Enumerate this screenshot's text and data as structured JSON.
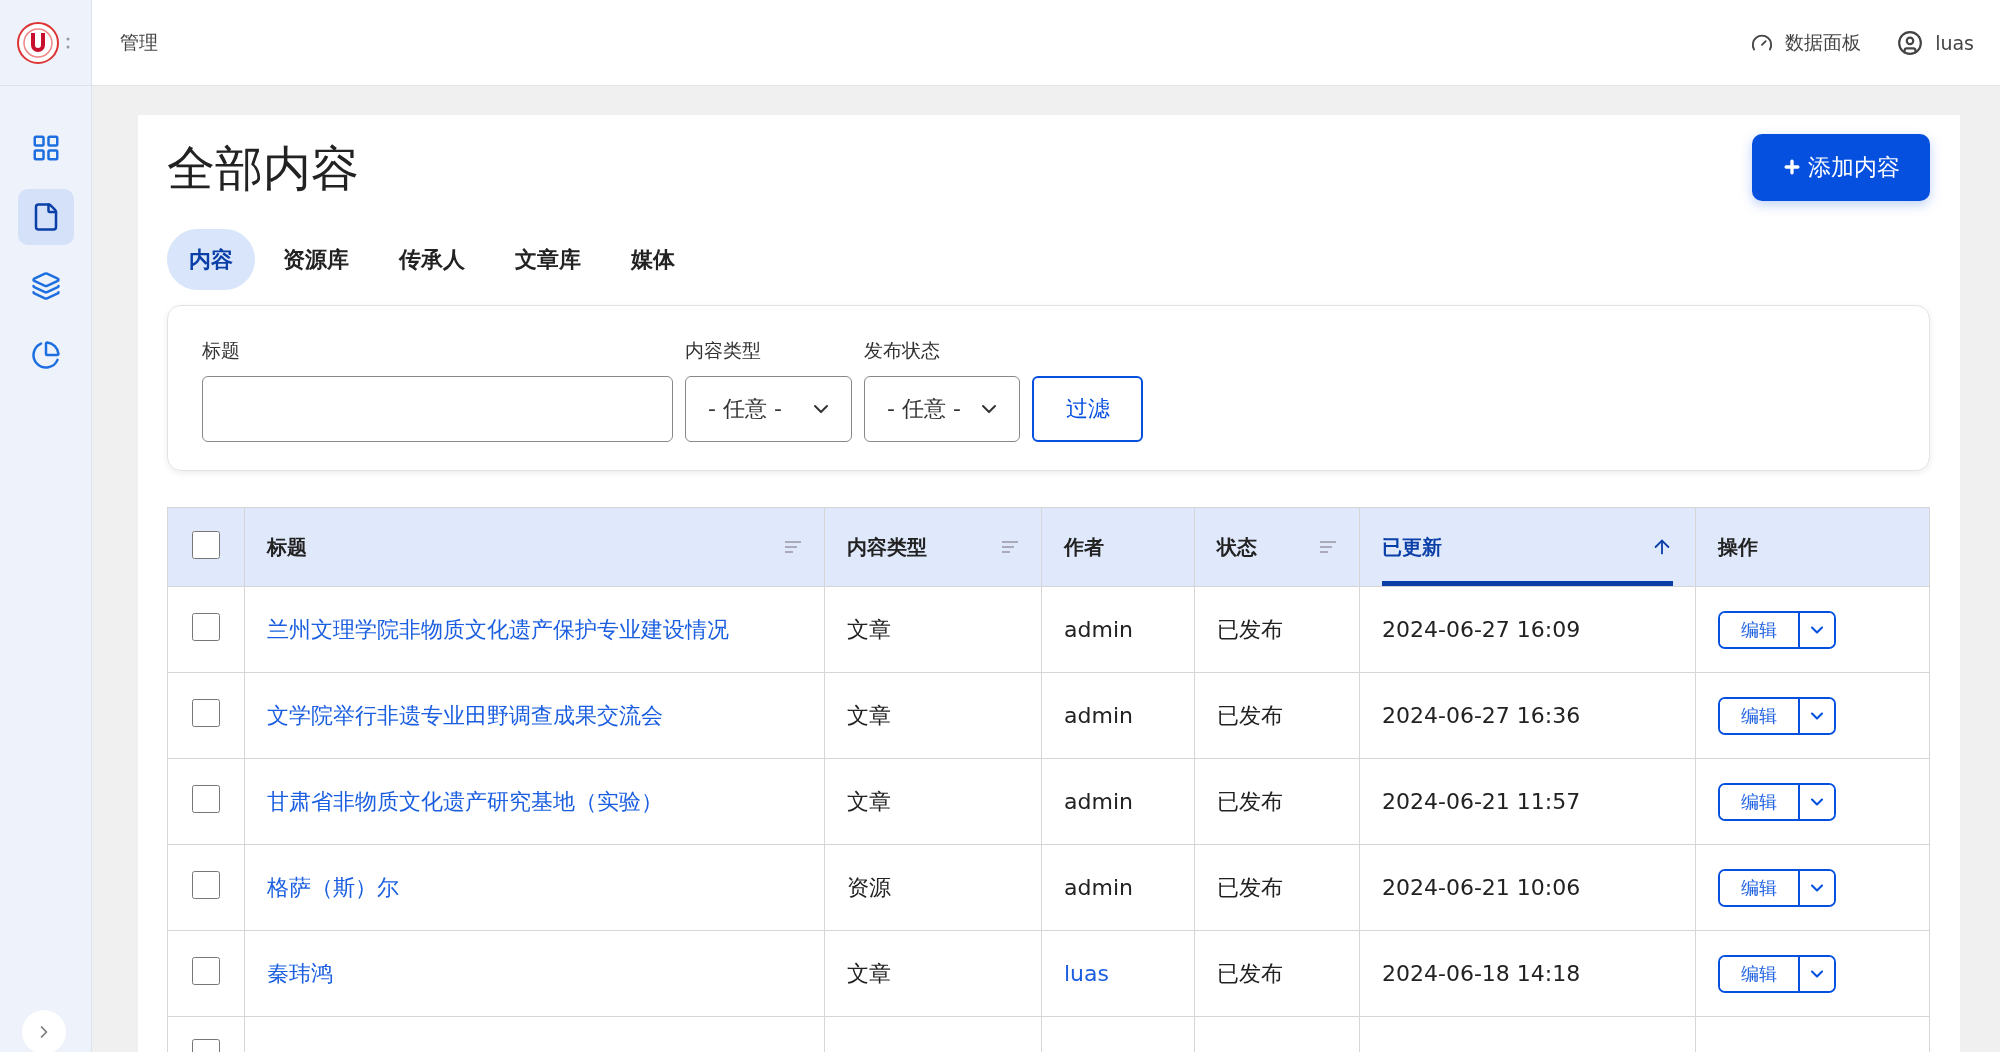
{
  "header": {
    "section": "管理",
    "links": [
      {
        "kind": "dashboard",
        "label": "数据面板"
      },
      {
        "kind": "user",
        "label": "luas"
      }
    ]
  },
  "sidebar": {
    "items": [
      {
        "kind": "grid",
        "selected": false
      },
      {
        "kind": "file",
        "selected": true
      },
      {
        "kind": "layers",
        "selected": false
      },
      {
        "kind": "chart",
        "selected": false
      }
    ]
  },
  "page": {
    "title": "全部内容",
    "add_button": "添加内容"
  },
  "tabs": [
    {
      "label": "内容",
      "selected": true
    },
    {
      "label": "资源库",
      "selected": false
    },
    {
      "label": "传承人",
      "selected": false
    },
    {
      "label": "文章库",
      "selected": false
    },
    {
      "label": "媒体",
      "selected": false
    }
  ],
  "filters": {
    "title_label": "标题",
    "type_label": "内容类型",
    "type_value": "- 任意 -",
    "status_label": "发布状态",
    "status_value": "- 任意 -",
    "button": "过滤"
  },
  "table": {
    "select_all_checked": false,
    "partial_row": {
      "checked": false
    },
    "columns": [
      {
        "label": "标题",
        "sortable": true,
        "sorted": false
      },
      {
        "label": "内容类型",
        "sortable": true,
        "sorted": false
      },
      {
        "label": "作者",
        "sortable": false,
        "sorted": false
      },
      {
        "label": "状态",
        "sortable": true,
        "sorted": false
      },
      {
        "label": "已更新",
        "sortable": true,
        "sorted": true
      },
      {
        "label": "操作",
        "sortable": false,
        "sorted": false
      }
    ],
    "rows": [
      {
        "title": "兰州文理学院非物质文化遗产保护专业建设情况",
        "type": "文章",
        "author": "admin",
        "author_link": false,
        "status": "已发布",
        "updated": "2024-06-27 16:09",
        "action": "编辑",
        "checked": false
      },
      {
        "title": "文学院举行非遗专业田野调查成果交流会",
        "type": "文章",
        "author": "admin",
        "author_link": false,
        "status": "已发布",
        "updated": "2024-06-27 16:36",
        "action": "编辑",
        "checked": false
      },
      {
        "title": "甘肃省非物质文化遗产研究基地（实验）",
        "type": "文章",
        "author": "admin",
        "author_link": false,
        "status": "已发布",
        "updated": "2024-06-21 11:57",
        "action": "编辑",
        "checked": false
      },
      {
        "title": "格萨（斯）尔",
        "type": "资源",
        "author": "admin",
        "author_link": false,
        "status": "已发布",
        "updated": "2024-06-21 10:06",
        "action": "编辑",
        "checked": false
      },
      {
        "title": "秦玮鸿",
        "type": "文章",
        "author": "luas",
        "author_link": true,
        "status": "已发布",
        "updated": "2024-06-18 14:18",
        "action": "编辑",
        "checked": false
      }
    ]
  }
}
